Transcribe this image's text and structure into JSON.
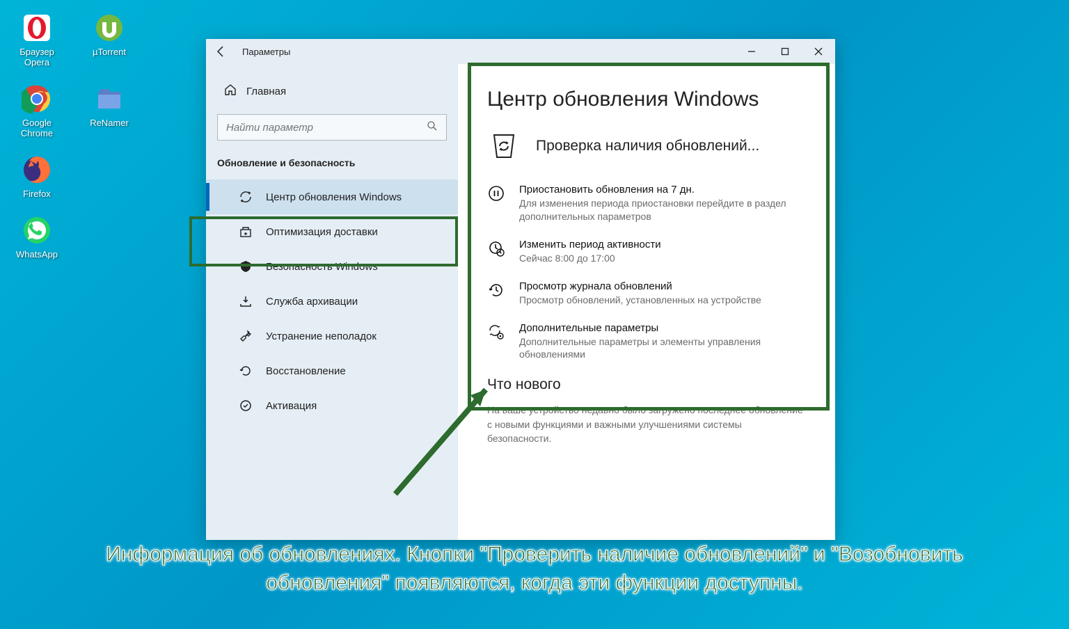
{
  "desktop": {
    "icons": [
      {
        "id": "opera",
        "label": "Браузер Opera"
      },
      {
        "id": "utorrent",
        "label": "µTorrent"
      },
      {
        "id": "chrome",
        "label": "Google Chrome"
      },
      {
        "id": "renamer",
        "label": "ReNamer"
      },
      {
        "id": "firefox",
        "label": "Firefox"
      },
      {
        "id": "whatsapp",
        "label": "WhatsApp"
      }
    ]
  },
  "window": {
    "title": "Параметры",
    "home": "Главная",
    "search_placeholder": "Найти параметр",
    "section": "Обновление и безопасность",
    "sidebar": [
      {
        "icon": "refresh",
        "label": "Центр обновления Windows",
        "selected": true
      },
      {
        "icon": "delivery",
        "label": "Оптимизация доставки",
        "selected": false
      },
      {
        "icon": "shield",
        "label": "Безопасность Windows",
        "selected": false
      },
      {
        "icon": "backup",
        "label": "Служба архивации",
        "selected": false
      },
      {
        "icon": "troubleshoot",
        "label": "Устранение неполадок",
        "selected": false
      },
      {
        "icon": "recovery",
        "label": "Восстановление",
        "selected": false
      },
      {
        "icon": "activation",
        "label": "Активация",
        "selected": false
      }
    ],
    "page": {
      "title": "Центр обновления Windows",
      "status": "Проверка наличия обновлений...",
      "options": [
        {
          "icon": "pause",
          "title": "Приостановить обновления на 7 дн.",
          "desc": "Для изменения периода приостановки перейдите в раздел дополнительных параметров"
        },
        {
          "icon": "clock",
          "title": "Изменить период активности",
          "desc": "Сейчас 8:00 до 17:00"
        },
        {
          "icon": "history",
          "title": "Просмотр журнала обновлений",
          "desc": "Просмотр обновлений, установленных на устройстве"
        },
        {
          "icon": "advanced",
          "title": "Дополнительные параметры",
          "desc": "Дополнительные параметры и элементы управления обновлениями"
        }
      ],
      "whats_new_title": "Что нового",
      "whats_new_body": "На ваше устройство недавно было загружено последнее обновление с новыми функциями и важными улучшениями системы безопасности."
    }
  },
  "annotation": {
    "caption": "Информация об обновлениях. Кнопки \"Проверить наличие обновлений\" и \"Возобновить обновления\" появляются, когда эти функции доступны."
  },
  "colors": {
    "highlight": "#2e6b2e"
  }
}
